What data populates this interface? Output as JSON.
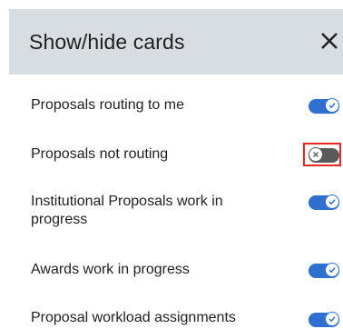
{
  "header": {
    "title": "Show/hide cards",
    "close_icon": "close-icon"
  },
  "cards": [
    {
      "label": "Proposals routing to me",
      "enabled": true
    },
    {
      "label": "Proposals not routing",
      "enabled": false
    },
    {
      "label": "Institutional Proposals work in progress",
      "enabled": true
    },
    {
      "label": "Awards work in progress",
      "enabled": true
    },
    {
      "label": "Proposal workload assignments",
      "enabled": true
    }
  ],
  "colors": {
    "header_bg": "#d8dde2",
    "toggle_on": "#2f6fcf",
    "toggle_off": "#5a5a5a",
    "highlight": "#e5281b"
  }
}
